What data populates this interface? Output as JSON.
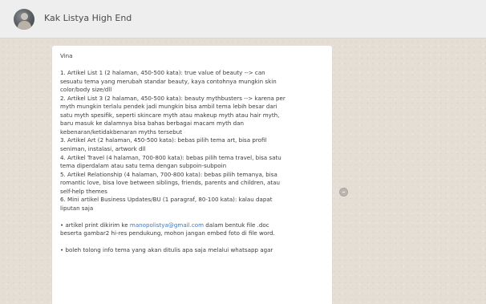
{
  "header": {
    "contact_name": "Kak Listya High End",
    "avatar_icon": "contact-avatar"
  },
  "message": {
    "greeting": "Vina",
    "lines": [
      "1. Artikel List 1 (2 halaman, 450-500 kata): true value of beauty --> can",
      "sesuatu tema yang merubah standar beauty, kaya contohnya mungkin skin",
      "color/body size/dll",
      "2. Artikel List 3 (2 halaman, 450-500 kata): beauty mythbusters --> karena per",
      "myth mungkin terlalu pendek jadi mungkin bisa ambil tema lebih besar dari",
      "satu myth spesifik, seperti skincare myth atau makeup myth atau hair myth,",
      "baru masuk ke dalamnya bisa bahas berbagai macam myth dan",
      "kebenaran/ketidakbenaran myths tersebut",
      "3. Artikel Art (2 halaman, 450-500 kata): bebas pilih tema art, bisa profil",
      "seniman, instalasi, artwork dll",
      "4. Artikel Travel (4 halaman, 700-800 kata): bebas pilih tema travel, bisa satu",
      "tema diperdalam atau satu tema dengan subpoin-subpoin",
      "5. Artikel Relationship (4 halaman, 700-800 kata): bebas pilih temanya, bisa",
      "romantic love, bisa love between siblings, friends, parents and children, atau",
      "self-help themes",
      "6. Mini artikel Business Updates/BU (1 paragraf, 80-100 kata): kalau dapat",
      "liputan saja"
    ],
    "note1_prefix": "• artikel print dikirim ke ",
    "note1_email": "manopolistya@gmail.com",
    "note1_suffix": " dalam bentuk file .doc",
    "note1_line2": "beserta gambar2 hi-res pendukung, mohon jangan embed foto di file word.",
    "note2": "• boleh tolong info tema yang akan ditulis apa saja melalui whatsapp agar"
  },
  "emoji_icon": "smiley-icon"
}
